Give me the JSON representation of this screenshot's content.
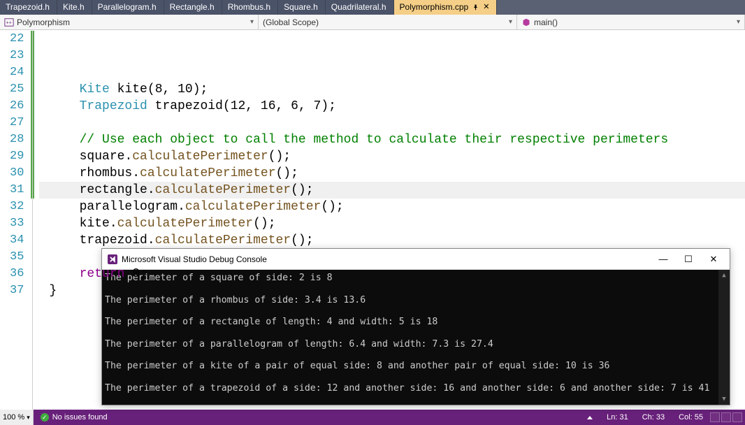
{
  "tabs": [
    {
      "label": "Trapezoid.h"
    },
    {
      "label": "Kite.h"
    },
    {
      "label": "Parallelogram.h"
    },
    {
      "label": "Rectangle.h"
    },
    {
      "label": "Rhombus.h"
    },
    {
      "label": "Square.h"
    },
    {
      "label": "Quadrilateral.h"
    },
    {
      "label": "Polymorphism.cpp"
    }
  ],
  "nav": {
    "project": "Polymorphism",
    "scope": "(Global Scope)",
    "func": "main()"
  },
  "lines": {
    "start": 22,
    "end": 37,
    "l22": "Kite kite(8, 10);",
    "l23": "Trapezoid trapezoid(12, 16, 6, 7);",
    "l25": "// Use each object to call the method to calculate their respective perimeters",
    "l26": "square.calculatePerimeter();",
    "l27": "rhombus.calculatePerimeter();",
    "l28": "rectangle.calculatePerimeter();",
    "l29": "parallelogram.calculatePerimeter();",
    "l30": "kite.calculatePerimeter();",
    "l31": "trapezoid.calculatePerimeter();",
    "l33": "return 0;",
    "l34": "}"
  },
  "console": {
    "title": "Microsoft Visual Studio Debug Console",
    "out": [
      "The perimeter of a square of side: 2 is 8",
      "The perimeter of a rhombus of side: 3.4 is 13.6",
      "The perimeter of a rectangle of length: 4 and width: 5 is 18",
      "The perimeter of a parallelogram of length: 6.4 and width: 7.3 is 27.4",
      "The perimeter of a kite of a pair of equal side: 8 and another pair of equal side: 10 is 36",
      "The perimeter of a trapezoid of a side: 12 and another side: 16 and another side: 6 and another side: 7 is 41"
    ]
  },
  "status": {
    "zoom": "100 %",
    "issues": "No issues found",
    "ln": "Ln: 31",
    "ch": "Ch: 33",
    "col": "Col: 55"
  }
}
